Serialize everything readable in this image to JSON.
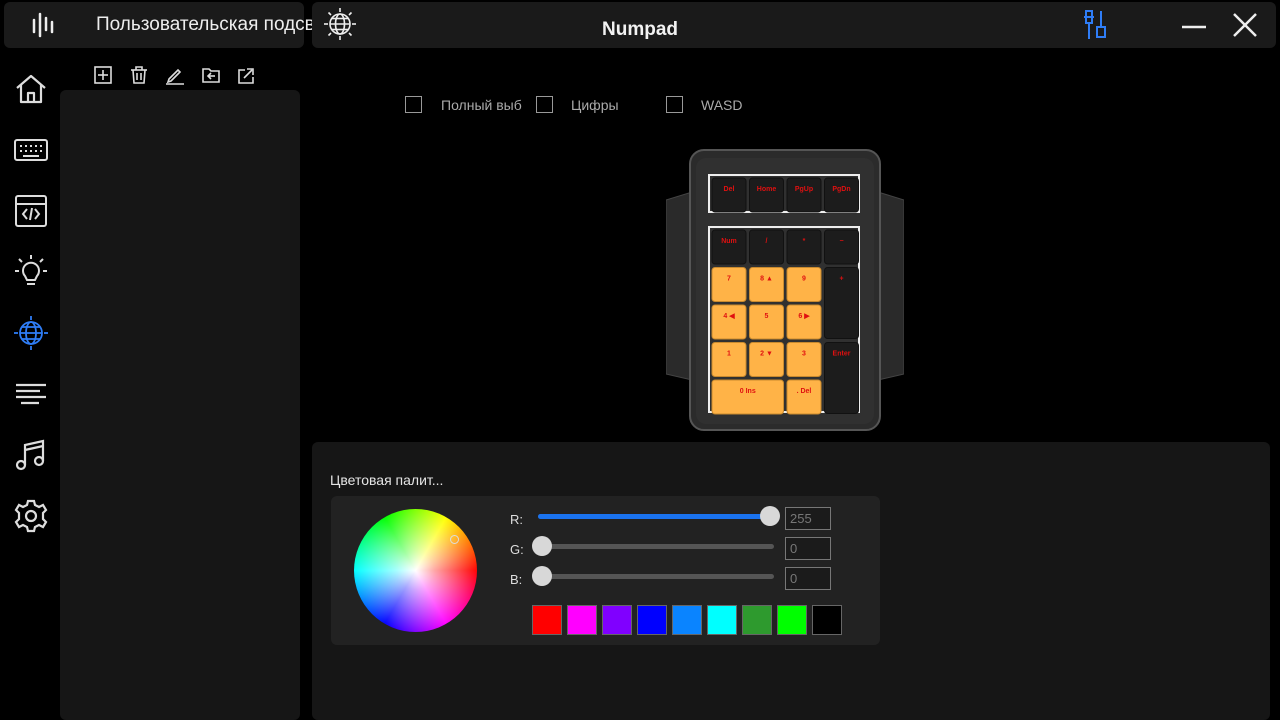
{
  "app": {
    "title": "Пользовательская подсвет"
  },
  "header": {
    "title": "Numpad"
  },
  "profile_toolbar": [
    "add-icon",
    "trash-icon",
    "edit-icon",
    "import-icon",
    "export-icon"
  ],
  "sidebar": {
    "items": [
      {
        "icon": "home-icon",
        "active": false
      },
      {
        "icon": "keyboard-icon",
        "active": false
      },
      {
        "icon": "macro-icon",
        "active": false
      },
      {
        "icon": "brightness-icon",
        "active": false
      },
      {
        "icon": "globe-icon",
        "active": true
      },
      {
        "icon": "lines-icon",
        "active": false
      },
      {
        "icon": "music-icon",
        "active": false
      },
      {
        "icon": "settings-icon",
        "active": false
      }
    ]
  },
  "selection": {
    "full": "Полный выб",
    "digits": "Цифры",
    "wasd": "WASD"
  },
  "numpad": {
    "top_row": [
      "Del",
      "Home",
      "PgUp",
      "PgDn"
    ],
    "rows": [
      [
        "Num",
        "/",
        "*",
        "−"
      ],
      [
        "7",
        "8 ▲",
        "9",
        "+"
      ],
      [
        "4 ◀",
        "5",
        "6 ▶"
      ],
      [
        "1",
        "2 ▼",
        "3",
        "Enter"
      ],
      [
        "0 Ins",
        ". Del"
      ]
    ],
    "highlight_color": "#ffb347",
    "legend_color": "#e01010"
  },
  "palette": {
    "title": "Цветовая палит...",
    "r_label": "R:",
    "g_label": "G:",
    "b_label": "B:",
    "r": "255",
    "g": "0",
    "b": "0",
    "swatches": [
      "#ff0000",
      "#ff00ff",
      "#8000ff",
      "#0000ff",
      "#0a84ff",
      "#00ffff",
      "#2e9a2e",
      "#00ff00",
      "#000000"
    ]
  },
  "colors": {
    "accent": "#1a73f0",
    "active_icon": "#2f7df6"
  }
}
